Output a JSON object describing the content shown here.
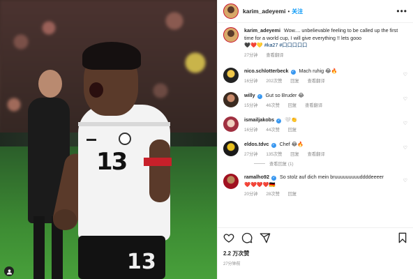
{
  "post": {
    "username": "karim_adeyemi",
    "separator": "•",
    "follow_label": "关注",
    "more_label": "•••",
    "image_alt": "Player celebrating in Germany #13 jersey"
  },
  "caption": {
    "username": "karim_adeyemi",
    "text": "Wow.... unbelievable feeling to be called up the first time for a world cup, I will give everything !! lets gooo",
    "emojis": "🖤❤️💛",
    "hashtags": "#ka27 #口口口口口",
    "time": "27分钟",
    "translate": "查看翻译"
  },
  "comments": [
    {
      "username": "nico.schlotterbeck",
      "verified": true,
      "text": "Mach ruhig 😂🔥",
      "time": "16分钟",
      "likes": "202次赞",
      "reply": "回复",
      "translate": "查看翻译"
    },
    {
      "username": "willy",
      "verified": true,
      "text": "Gut so Bruder 😂",
      "time": "15分钟",
      "likes": "46次赞",
      "reply": "回复",
      "translate": "查看翻译"
    },
    {
      "username": "ismailjakobs",
      "verified": true,
      "text": "🤍👏",
      "time": "16分钟",
      "likes": "44次赞",
      "reply": "回复",
      "translate": ""
    },
    {
      "username": "eldos.tdvc",
      "verified": true,
      "text": "Chef 😂🔥",
      "time": "27分钟",
      "likes": "135次赞",
      "reply": "回复",
      "translate": "查看翻译",
      "view_replies": "查看回复 (1)"
    },
    {
      "username": "ramalho92",
      "verified": true,
      "text": "So stolz auf dich mein bruuuuuuuuuddddeeeer",
      "emojis": "❤️❤️❤️❤️🇩🇪",
      "time": "20分钟",
      "likes": "28次赞",
      "reply": "回复",
      "translate": ""
    }
  ],
  "footer": {
    "likes": "2.2 万次赞",
    "time": "27分钟前"
  },
  "colors": {
    "accent": "#0095f6",
    "verified": "#3897f0",
    "muted": "#8e8e8e"
  }
}
